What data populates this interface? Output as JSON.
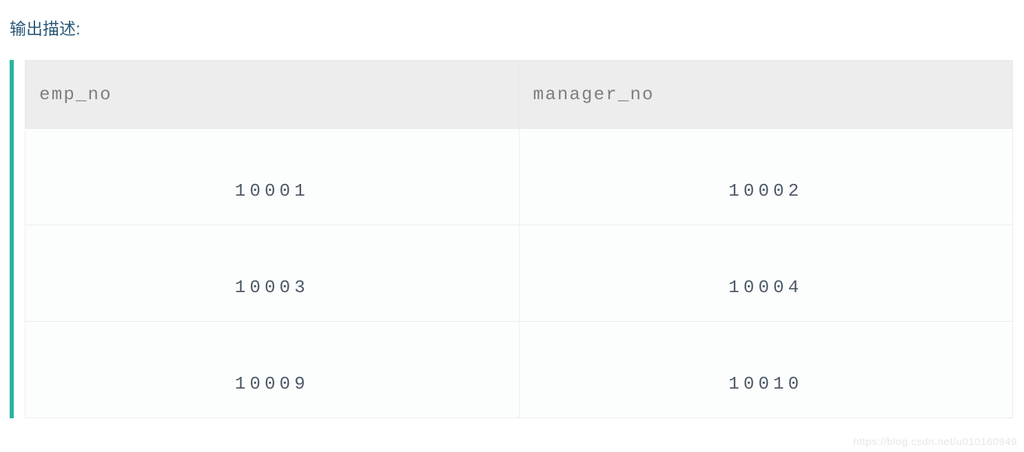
{
  "title": "输出描述:",
  "table": {
    "headers": [
      "emp_no",
      "manager_no"
    ],
    "rows": [
      {
        "emp_no": "10001",
        "manager_no": "10002"
      },
      {
        "emp_no": "10003",
        "manager_no": "10004"
      },
      {
        "emp_no": "10009",
        "manager_no": "10010"
      }
    ]
  },
  "watermark": "https://blog.csdn.net/u010160949"
}
